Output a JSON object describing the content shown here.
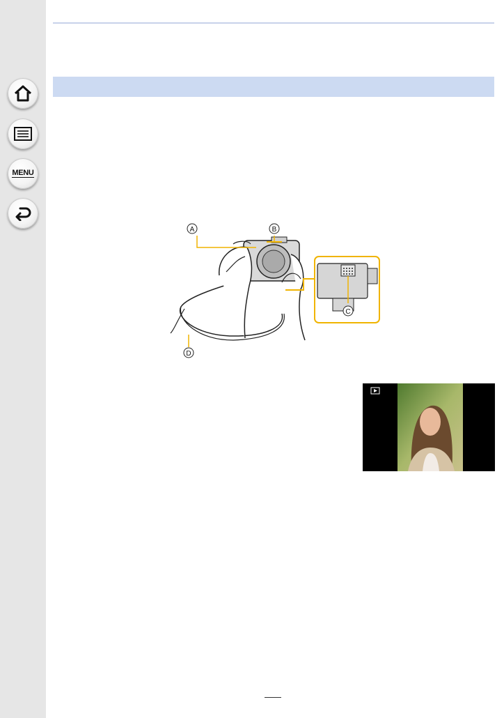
{
  "sidebar": {
    "buttons": [
      {
        "name": "home",
        "icon": "home-icon"
      },
      {
        "name": "contents",
        "icon": "list-icon"
      },
      {
        "name": "menu",
        "icon": "menu-icon",
        "label": "MENU"
      },
      {
        "name": "back",
        "icon": "back-arrow-icon"
      }
    ]
  },
  "illustration": {
    "callouts": [
      "A",
      "B",
      "C",
      "D"
    ],
    "accent_color": "#f0b400"
  },
  "lcd": {
    "play_icon": "playback-icon"
  }
}
